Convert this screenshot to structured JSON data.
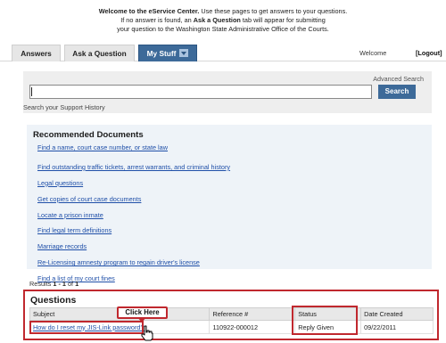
{
  "welcome": {
    "line1_bold": "Welcome to the eService Center.",
    "line1_rest": " Use these pages to get answers to your questions.",
    "line2_pre": "If no answer is found, an ",
    "line2_bold": "Ask a Question",
    "line2_post": " tab will appear for submitting",
    "line3": "your question to the Washington State Administrative Office of the Courts."
  },
  "nav": {
    "tabs": [
      {
        "label": "Answers"
      },
      {
        "label": "Ask a Question"
      },
      {
        "label": "My Stuff"
      }
    ],
    "welcome_text": "Welcome",
    "logout_label": "[Logout]",
    "active_tab_color": "#3d6a99"
  },
  "search": {
    "advanced_label": "Advanced Search",
    "input_value": "",
    "button_label": "Search",
    "support_history": "Search your Support History"
  },
  "recommended": {
    "title": "Recommended Documents",
    "items": [
      {
        "label": "Find a name, court case number, or state law"
      },
      {
        "label": "Find outstanding traffic tickets, arrest warrants, and criminal history"
      },
      {
        "label": "Legal questions"
      },
      {
        "label": "Get copies of court case documents"
      },
      {
        "label": "Locate a prison inmate"
      },
      {
        "label": "Find legal term definitions"
      },
      {
        "label": "Marriage records"
      },
      {
        "label": "Re-Licensing amnesty program to regain driver's license"
      },
      {
        "label": "Find a list of my court fines"
      }
    ]
  },
  "results": {
    "prefix": "Results ",
    "range": "1 - 1",
    "of_text": " of ",
    "total": "1"
  },
  "questions": {
    "title": "Questions",
    "columns": [
      "Subject",
      "Reference #",
      "Status",
      "Date Created"
    ],
    "rows": [
      {
        "subject": "How do I reset my JIS-Link password?",
        "reference": "110922-000012",
        "status": "Reply Given",
        "date": "09/22/2011"
      }
    ]
  },
  "annotation": {
    "callout_label": "Click Here",
    "highlight_color": "#c0282e"
  }
}
